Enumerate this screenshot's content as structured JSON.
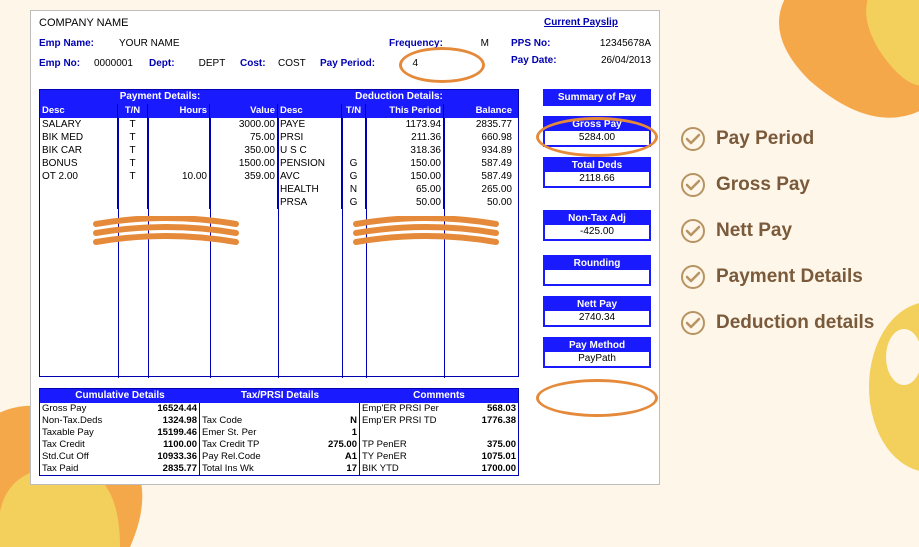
{
  "company": "COMPANY NAME",
  "emp_name_label": "Emp Name:",
  "emp_name": "YOUR NAME",
  "emp_no_label": "Emp No:",
  "emp_no": "0000001",
  "dept_label": "Dept:",
  "dept": "DEPT",
  "cost_label": "Cost:",
  "cost": "COST",
  "freq_label": "Frequency:",
  "freq": "M",
  "pay_period_label": "Pay Period:",
  "pay_period": "4",
  "current_payslip": "Current Payslip",
  "pps_label": "PPS No:",
  "pps": "12345678A",
  "pay_date_label": "Pay Date:",
  "pay_date": "26/04/2013",
  "payment_details_title": "Payment Details:",
  "deduction_details_title": "Deduction Details:",
  "pay_cols": {
    "desc": "Desc",
    "tn": "T/N",
    "hours": "Hours",
    "value": "Value"
  },
  "ded_cols": {
    "desc": "Desc",
    "tn": "T/N",
    "this": "This Period",
    "bal": "Balance"
  },
  "pay_rows": [
    {
      "desc": "SALARY",
      "tn": "T",
      "hours": "",
      "value": "3000.00"
    },
    {
      "desc": "BIK MED",
      "tn": "T",
      "hours": "",
      "value": "75.00"
    },
    {
      "desc": "BIK CAR",
      "tn": "T",
      "hours": "",
      "value": "350.00"
    },
    {
      "desc": "BONUS",
      "tn": "T",
      "hours": "",
      "value": "1500.00"
    },
    {
      "desc": "OT 2.00",
      "tn": "T",
      "hours": "10.00",
      "value": "359.00"
    }
  ],
  "ded_rows": [
    {
      "desc": "PAYE",
      "tn": "",
      "this": "1173.94",
      "bal": "2835.77"
    },
    {
      "desc": "PRSI",
      "tn": "",
      "this": "211.36",
      "bal": "660.98"
    },
    {
      "desc": "U S C",
      "tn": "",
      "this": "318.36",
      "bal": "934.89"
    },
    {
      "desc": "PENSION",
      "tn": "G",
      "this": "150.00",
      "bal": "587.49"
    },
    {
      "desc": "AVC",
      "tn": "G",
      "this": "150.00",
      "bal": "587.49"
    },
    {
      "desc": "HEALTH",
      "tn": "N",
      "this": "65.00",
      "bal": "265.00"
    },
    {
      "desc": "PRSA",
      "tn": "G",
      "this": "50.00",
      "bal": "50.00"
    }
  ],
  "summary": {
    "summary_title": "Summary of Pay",
    "gross_title": "Gross Pay",
    "gross": "5284.00",
    "total_deds_title": "Total Deds",
    "total_deds": "2118.66",
    "nontax_title": "Non-Tax Adj",
    "nontax": "-425.00",
    "rounding_title": "Rounding",
    "rounding": "",
    "nett_title": "Nett Pay",
    "nett": "2740.34",
    "method_title": "Pay Method",
    "method": "PayPath"
  },
  "cumulative_title": "Cumulative Details",
  "taxprsi_title": "Tax/PRSI Details",
  "comments_title": "Comments",
  "cum_rows": [
    {
      "l": "Gross Pay",
      "v": "16524.44"
    },
    {
      "l": "Non-Tax.Deds",
      "v": "1324.98"
    },
    {
      "l": "Taxable Pay",
      "v": "15199.46"
    },
    {
      "l": "Tax Credit",
      "v": "1100.00"
    },
    {
      "l": "Std.Cut Off",
      "v": "10933.36"
    },
    {
      "l": "Tax Paid",
      "v": "2835.77"
    }
  ],
  "tp_rows": [
    {
      "l": "Tax Code",
      "v": "N"
    },
    {
      "l": "Emer St. Per",
      "v": "1"
    },
    {
      "l": "Tax Credit TP",
      "v": "275.00"
    },
    {
      "l": "Pay Rel.Code",
      "v": "A1"
    },
    {
      "l": "Total Ins Wk",
      "v": "17"
    }
  ],
  "cm_rows": [
    {
      "l": "Emp'ER PRSI Per",
      "v": "568.03"
    },
    {
      "l": "Emp'ER PRSI TD",
      "v": "1776.38"
    },
    {
      "l": "",
      "v": ""
    },
    {
      "l": "TP PenER",
      "v": "375.00"
    },
    {
      "l": "TY PenER",
      "v": "1075.01"
    },
    {
      "l": "BIK YTD",
      "v": "1700.00"
    }
  ],
  "checklist": [
    "Pay Period",
    "Gross Pay",
    "Nett Pay",
    "Payment Details",
    "Deduction details"
  ]
}
